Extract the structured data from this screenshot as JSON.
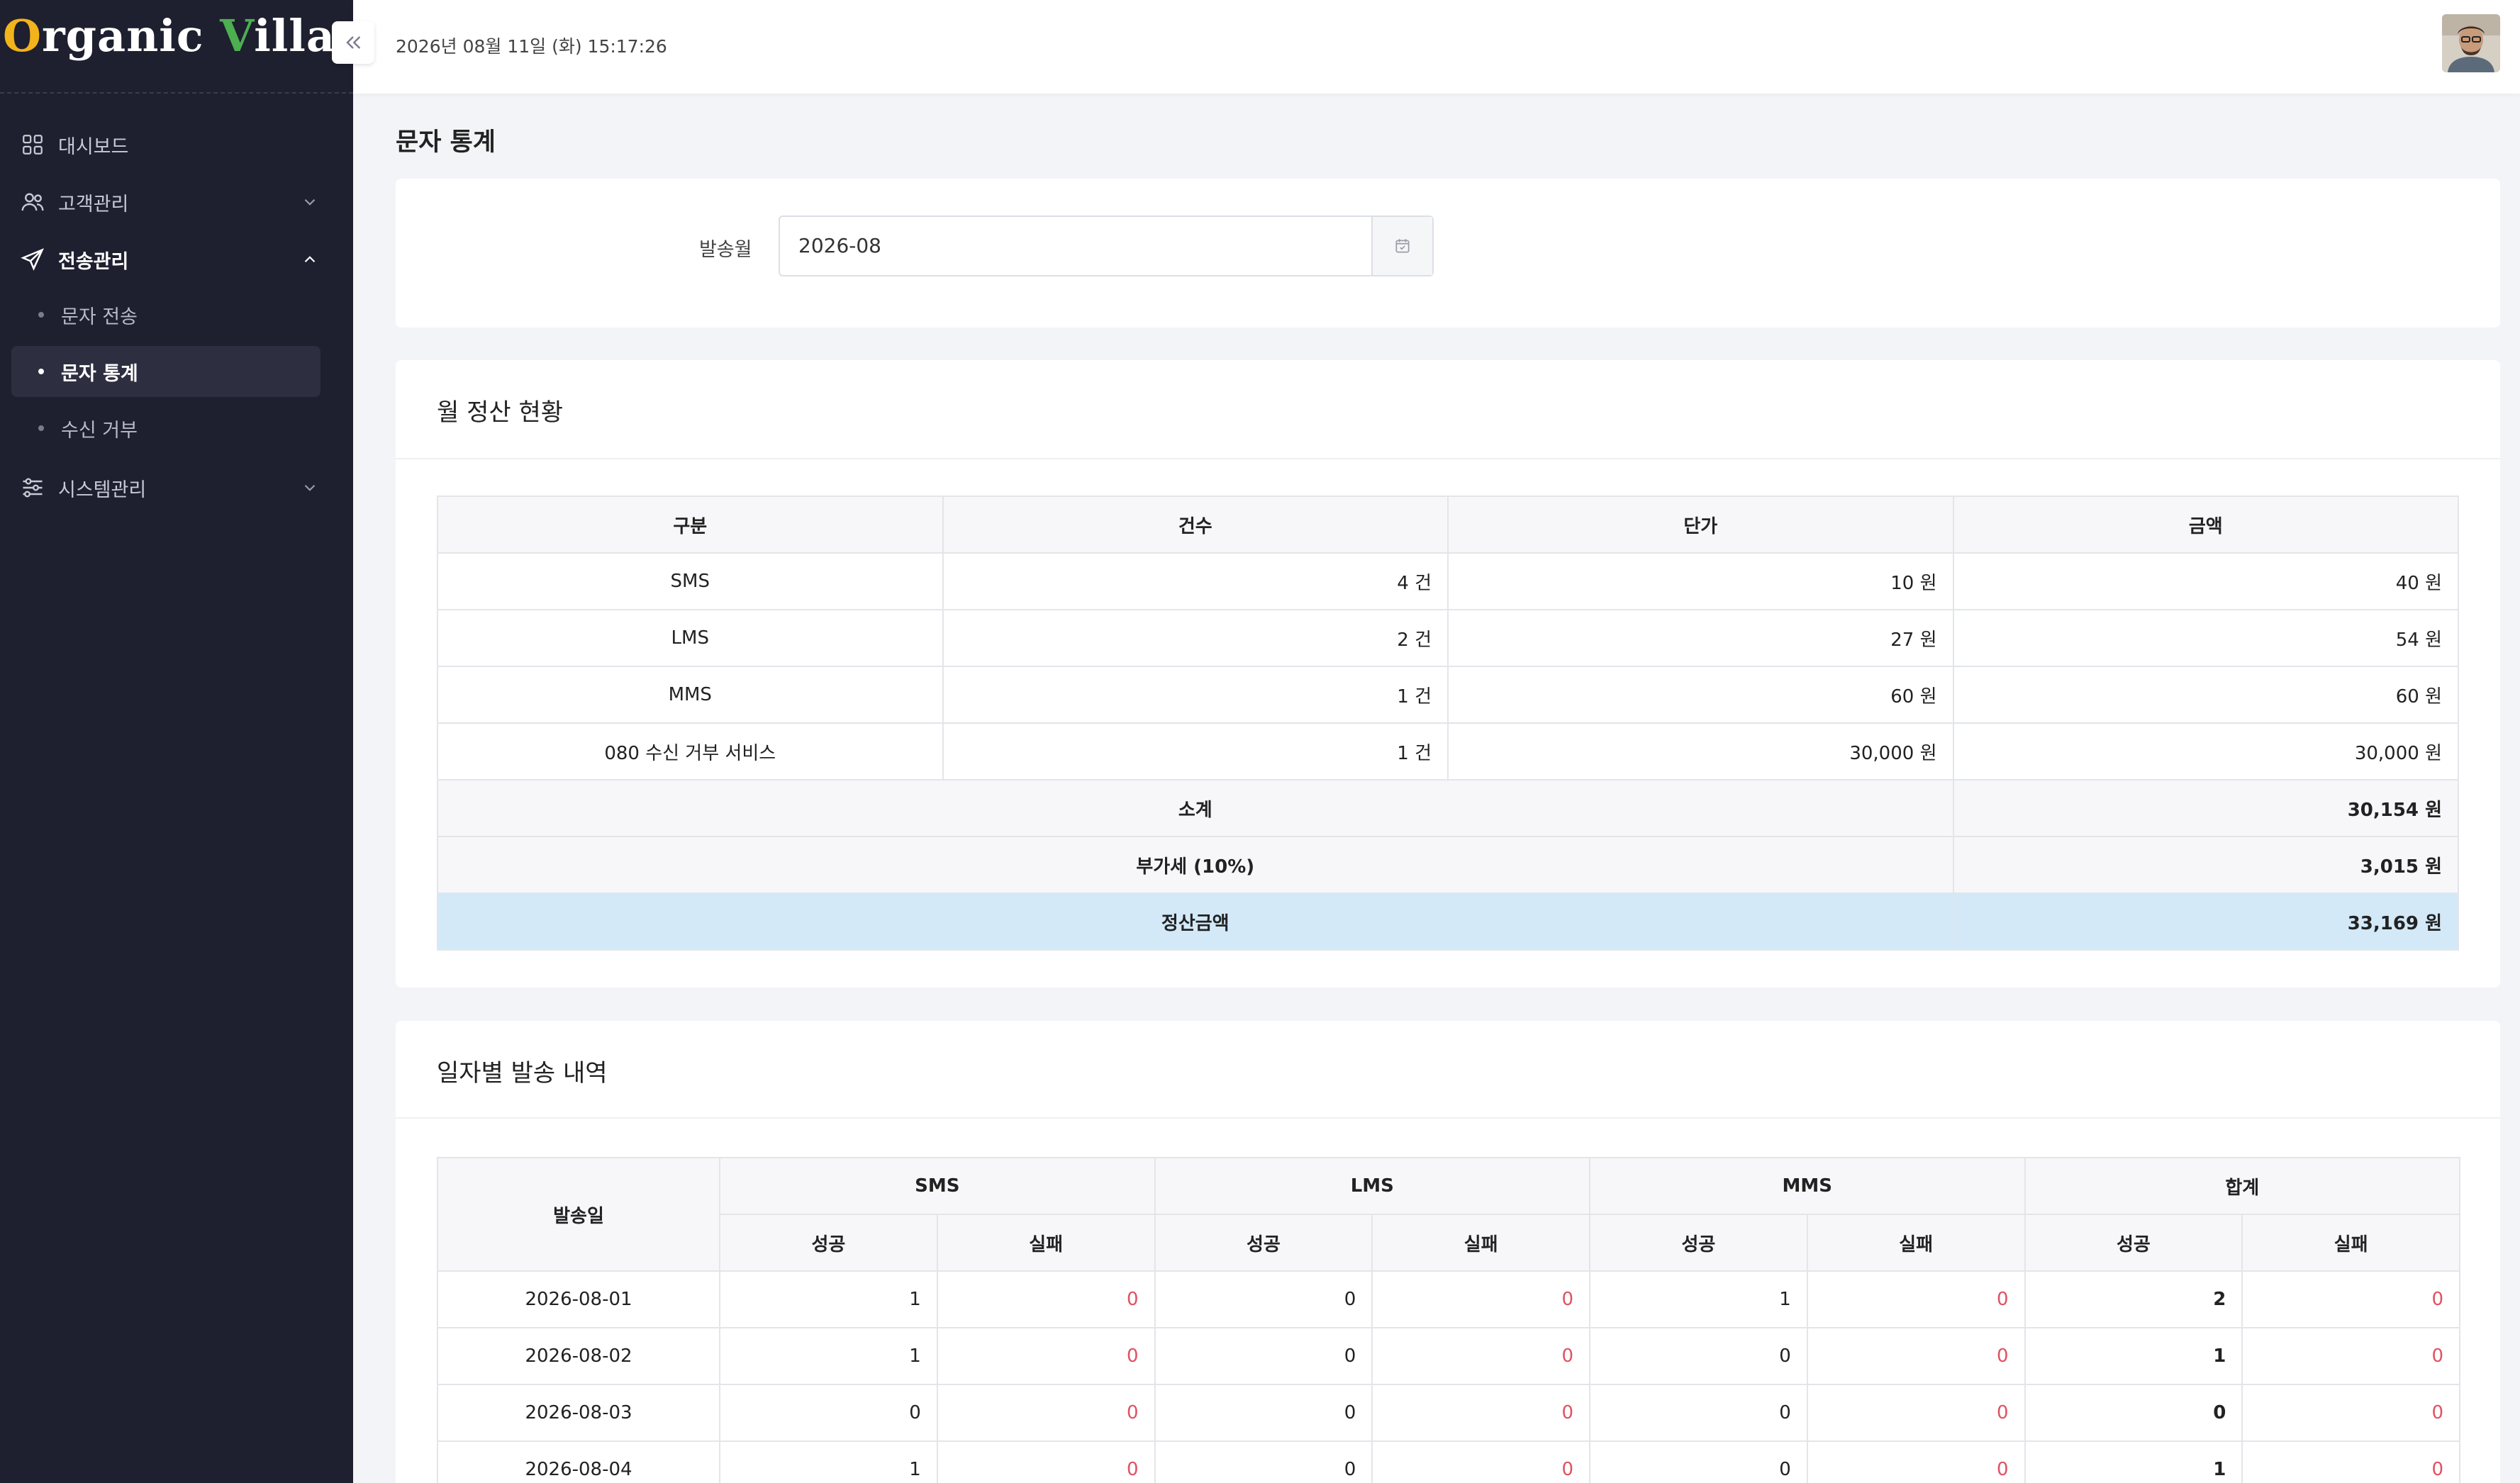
{
  "app": {
    "logo_first_letter": "O",
    "logo_rest1": "rganic ",
    "logo_v": "V",
    "logo_rest2": "illages",
    "datetime": "2026년 08월 11일 (화) 15:17:26"
  },
  "sidebar": {
    "items": [
      {
        "label": "대시보드",
        "icon": "dashboard-grid-icon"
      },
      {
        "label": "고객관리",
        "icon": "users-icon"
      },
      {
        "label": "전송관리",
        "icon": "send-icon"
      },
      {
        "label": "시스템관리",
        "icon": "sliders-icon"
      }
    ],
    "sub_items": [
      {
        "label": "문자 전송"
      },
      {
        "label": "문자 통계"
      },
      {
        "label": "수신 거부"
      }
    ]
  },
  "page": {
    "title": "문자 통계",
    "filter_label": "발송월",
    "filter_value": "2026-08"
  },
  "settlement": {
    "title": "월 정산 현황",
    "headers": [
      "구분",
      "건수",
      "단가",
      "금액"
    ],
    "rows": [
      [
        "SMS",
        "4 건",
        "10 원",
        "40 원"
      ],
      [
        "LMS",
        "2 건",
        "27 원",
        "54 원"
      ],
      [
        "MMS",
        "1 건",
        "60 원",
        "60 원"
      ],
      [
        "080 수신 거부 서비스",
        "1 건",
        "30,000 원",
        "30,000 원"
      ]
    ],
    "subtotal_label": "소계",
    "subtotal_value": "30,154 원",
    "vat_label": "부가세 (10%)",
    "vat_value": "3,015 원",
    "total_label": "정산금액",
    "total_value": "33,169 원"
  },
  "daily": {
    "title": "일자별 발송 내역",
    "date_header": "발송일",
    "group_headers": [
      "SMS",
      "LMS",
      "MMS",
      "합계"
    ],
    "sub_headers": [
      "성공",
      "실패",
      "성공",
      "실패",
      "성공",
      "실패",
      "성공",
      "실패"
    ],
    "rows": [
      [
        "2026-08-01",
        "1",
        "0",
        "0",
        "0",
        "1",
        "0",
        "2",
        "0"
      ],
      [
        "2026-08-02",
        "1",
        "0",
        "0",
        "0",
        "0",
        "0",
        "1",
        "0"
      ],
      [
        "2026-08-03",
        "0",
        "0",
        "0",
        "0",
        "0",
        "0",
        "0",
        "0"
      ],
      [
        "2026-08-04",
        "1",
        "0",
        "0",
        "0",
        "0",
        "0",
        "1",
        "0"
      ]
    ]
  },
  "colors": {
    "sidebar_bg": "#1e1f2f",
    "fail_red": "#e05264",
    "total_row_bg": "#d3e9f8",
    "logo_o": "#f2b31b",
    "logo_v": "#4caf50"
  }
}
